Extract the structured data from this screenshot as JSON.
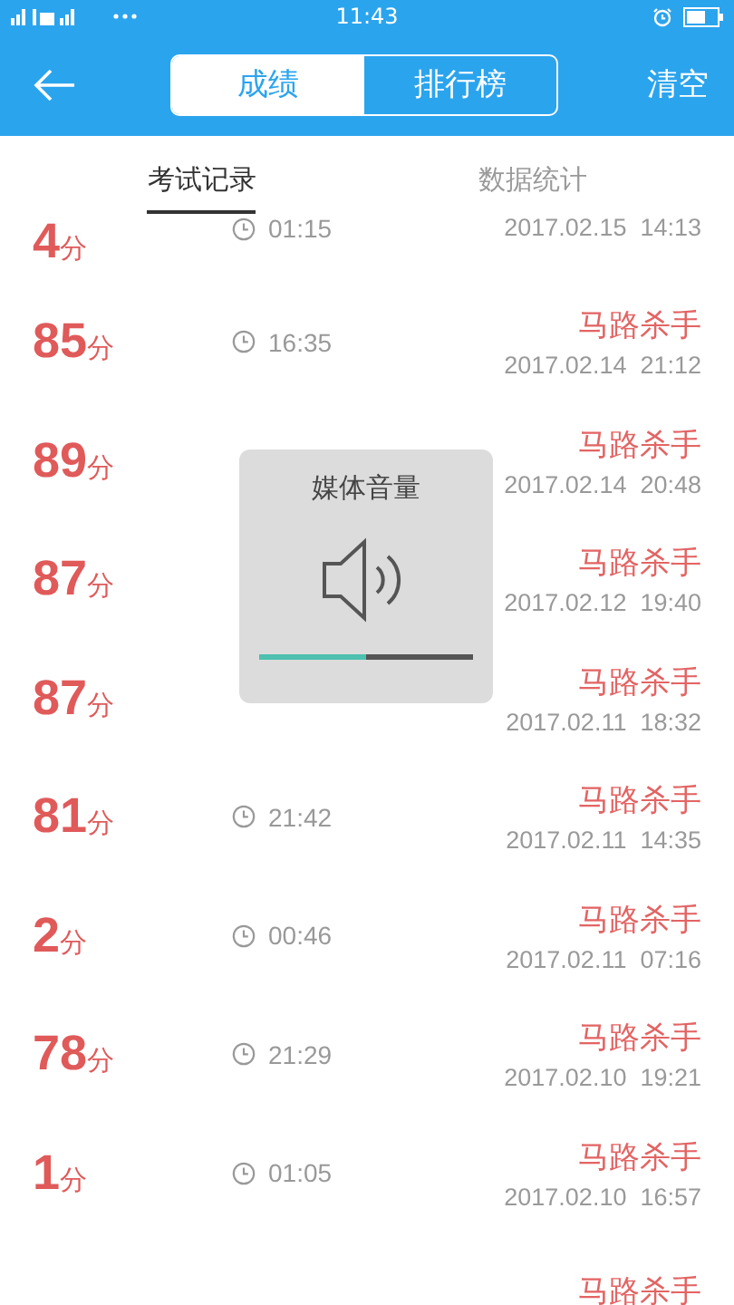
{
  "status_bar": {
    "time": "11:43"
  },
  "nav": {
    "segments": [
      {
        "label": "成绩",
        "selected": true
      },
      {
        "label": "排行榜",
        "selected": false
      }
    ],
    "action": "清空"
  },
  "tabs": [
    {
      "label": "考试记录",
      "selected": true
    },
    {
      "label": "数据统计",
      "selected": false
    }
  ],
  "records": [
    {
      "score": "4",
      "unit": "分",
      "time": "01:15",
      "date": "2017.02.15  14:13"
    },
    {
      "score": "85",
      "unit": "分",
      "time": "16:35",
      "name": "马路杀手",
      "date": "2017.02.14  21:12"
    },
    {
      "score": "89",
      "unit": "分",
      "name": "马路杀手",
      "date": "2017.02.14  20:48"
    },
    {
      "score": "87",
      "unit": "分",
      "name": "马路杀手",
      "date": "2017.02.12  19:40"
    },
    {
      "score": "87",
      "unit": "分",
      "name": "马路杀手",
      "date": "2017.02.11  18:32"
    },
    {
      "score": "81",
      "unit": "分",
      "time": "21:42",
      "name": "马路杀手",
      "date": "2017.02.11  14:35"
    },
    {
      "score": "2",
      "unit": "分",
      "time": "00:46",
      "name": "马路杀手",
      "date": "2017.02.11  07:16"
    },
    {
      "score": "78",
      "unit": "分",
      "time": "21:29",
      "name": "马路杀手",
      "date": "2017.02.10  19:21"
    },
    {
      "score": "1",
      "unit": "分",
      "time": "01:05",
      "name": "马路杀手",
      "date": "2017.02.10  16:57"
    },
    {
      "name": "马路杀手"
    }
  ],
  "volume": {
    "title": "媒体音量",
    "level": 0.5
  }
}
